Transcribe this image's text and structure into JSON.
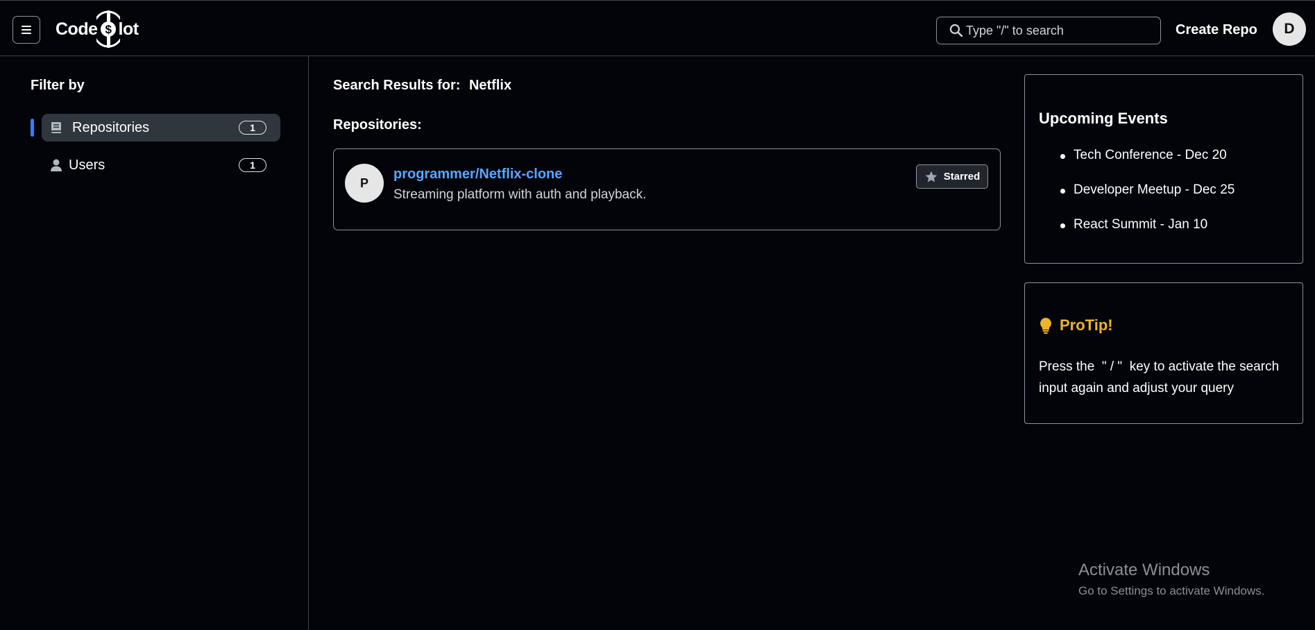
{
  "header": {
    "logo_left": "Code",
    "logo_right": "lot",
    "search_placeholder": "Type \"/\" to search",
    "create_repo_label": "Create Repo",
    "user_initial": "D"
  },
  "sidebar": {
    "title": "Filter by",
    "items": [
      {
        "label": "Repositories",
        "count": "1",
        "icon": "repo-book-icon",
        "active": true
      },
      {
        "label": "Users",
        "count": "1",
        "icon": "user-icon",
        "active": false
      }
    ]
  },
  "main": {
    "results_prefix": "Search Results for:",
    "query": "Netflix",
    "repositories_label": "Repositories:",
    "repos": [
      {
        "avatar_initial": "P",
        "name": "programmer/Netflix-clone",
        "description": "Streaming platform with auth and playback.",
        "star_label": "Starred",
        "star_icon": "star-icon"
      }
    ]
  },
  "events": {
    "title": "Upcoming Events",
    "items": [
      "Tech Conference - Dec 20",
      "Developer Meetup - Dec 25",
      "React Summit - Jan 10"
    ]
  },
  "protip": {
    "title": "ProTip!",
    "icon": "lightbulb-icon",
    "text": "Press the  \" / \"  key to activate the search input again and adjust your query"
  },
  "watermark": {
    "title": "Activate Windows",
    "subtitle": "Go to Settings to activate Windows."
  },
  "colors": {
    "background": "#02040a",
    "accent_blue": "#2f81f7",
    "link": "#58a6ff",
    "protip": "#f0b429"
  }
}
